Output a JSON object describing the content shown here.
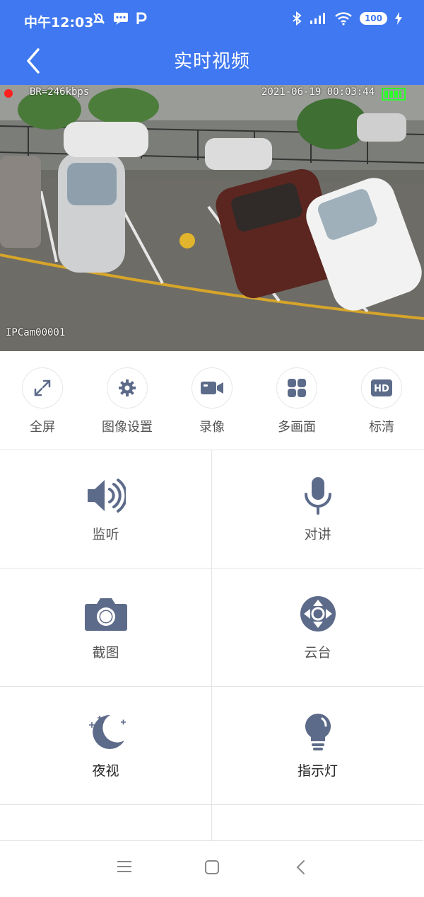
{
  "status_bar": {
    "time": "中午12:03",
    "battery": "100"
  },
  "header": {
    "title": "实时视频"
  },
  "video": {
    "bitrate": "BR=246kbps",
    "datetime": "2021-06-19 00:03:44",
    "camera_name": "IPCam00001"
  },
  "toolbar": {
    "items": [
      {
        "label": "全屏",
        "icon": "expand-icon"
      },
      {
        "label": "图像设置",
        "icon": "gear-icon"
      },
      {
        "label": "录像",
        "icon": "video-camera-icon"
      },
      {
        "label": "多画面",
        "icon": "grid-icon"
      },
      {
        "label": "标清",
        "icon": "hd-icon",
        "badge": "HD"
      }
    ]
  },
  "controls": {
    "items": [
      {
        "label": "监听",
        "icon": "speaker-icon"
      },
      {
        "label": "对讲",
        "icon": "microphone-icon"
      },
      {
        "label": "截图",
        "icon": "camera-icon"
      },
      {
        "label": "云台",
        "icon": "ptz-icon"
      },
      {
        "label": "夜视",
        "icon": "moon-icon"
      },
      {
        "label": "指示灯",
        "icon": "lightbulb-icon"
      }
    ]
  },
  "colors": {
    "header_bg": "#3f78f0",
    "icon": "#5d6b8a"
  }
}
